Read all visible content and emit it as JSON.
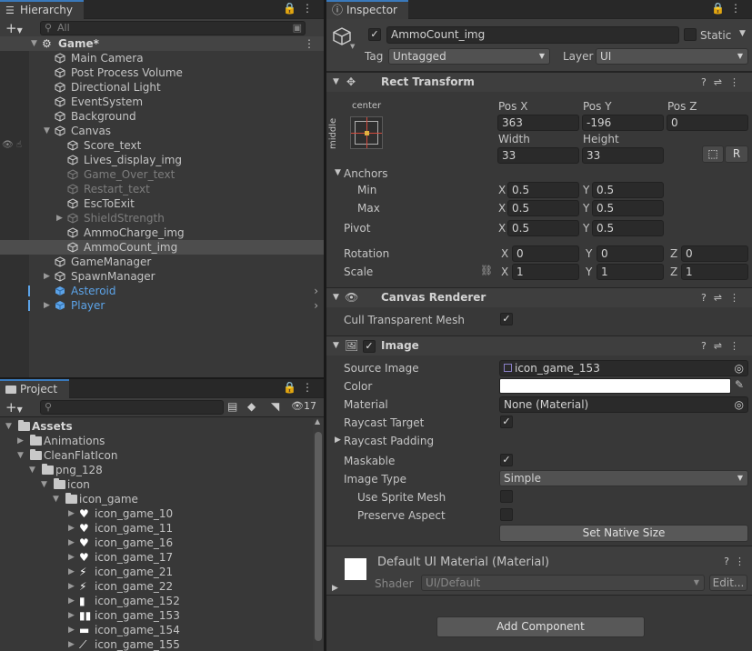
{
  "hierarchy": {
    "tab": "Hierarchy",
    "search_placeholder": "All",
    "root": "Game*",
    "items": [
      {
        "label": "Main Camera"
      },
      {
        "label": "Post Process Volume"
      },
      {
        "label": "Directional Light"
      },
      {
        "label": "EventSystem"
      },
      {
        "label": "Background"
      },
      {
        "label": "Canvas"
      },
      {
        "label": "Score_text"
      },
      {
        "label": "Lives_display_img"
      },
      {
        "label": "Game_Over_text"
      },
      {
        "label": "Restart_text"
      },
      {
        "label": "EscToExit"
      },
      {
        "label": "ShieldStrength"
      },
      {
        "label": "AmmoCharge_img"
      },
      {
        "label": "AmmoCount_img"
      },
      {
        "label": "GameManager"
      },
      {
        "label": "SpawnManager"
      },
      {
        "label": "Asteroid"
      },
      {
        "label": "Player"
      }
    ]
  },
  "project": {
    "tab": "Project",
    "badge": "17",
    "tree": [
      {
        "label": "Assets"
      },
      {
        "label": "Animations"
      },
      {
        "label": "CleanFlatIcon"
      },
      {
        "label": "png_128"
      },
      {
        "label": "icon"
      },
      {
        "label": "icon_game"
      },
      {
        "label": "icon_game_10"
      },
      {
        "label": "icon_game_11"
      },
      {
        "label": "icon_game_16"
      },
      {
        "label": "icon_game_17"
      },
      {
        "label": "icon_game_21"
      },
      {
        "label": "icon_game_22"
      },
      {
        "label": "icon_game_152"
      },
      {
        "label": "icon_game_153"
      },
      {
        "label": "icon_game_154"
      },
      {
        "label": "icon_game_155"
      }
    ]
  },
  "inspector": {
    "tab": "Inspector",
    "object_name": "AmmoCount_img",
    "static_label": "Static",
    "tag_label": "Tag",
    "tag_value": "Untagged",
    "layer_label": "Layer",
    "layer_value": "UI",
    "rect": {
      "title": "Rect Transform",
      "anchor_top": "center",
      "anchor_side": "middle",
      "posx_label": "Pos X",
      "posy_label": "Pos Y",
      "posz_label": "Pos Z",
      "posx": "363",
      "posy": "-196",
      "posz": "0",
      "width_label": "Width",
      "height_label": "Height",
      "width": "33",
      "height": "33",
      "r_label": "R",
      "anchors_label": "Anchors",
      "min_label": "Min",
      "max_label": "Max",
      "min_x": "0.5",
      "min_y": "0.5",
      "max_x": "0.5",
      "max_y": "0.5",
      "pivot_label": "Pivot",
      "pivot_x": "0.5",
      "pivot_y": "0.5",
      "rotation_label": "Rotation",
      "rot_x": "0",
      "rot_y": "0",
      "rot_z": "0",
      "scale_label": "Scale",
      "scale_x": "1",
      "scale_y": "1",
      "scale_z": "1",
      "x": "X",
      "y": "Y",
      "z": "Z"
    },
    "canvas_renderer": {
      "title": "Canvas Renderer",
      "cull_label": "Cull Transparent Mesh"
    },
    "image": {
      "title": "Image",
      "source_label": "Source Image",
      "source_value": "icon_game_153",
      "color_label": "Color",
      "material_label": "Material",
      "material_value": "None (Material)",
      "raycast_target_label": "Raycast Target",
      "raycast_padding_label": "Raycast Padding",
      "maskable_label": "Maskable",
      "image_type_label": "Image Type",
      "image_type_value": "Simple",
      "use_sprite_mesh_label": "Use Sprite Mesh",
      "preserve_aspect_label": "Preserve Aspect",
      "set_native_label": "Set Native Size"
    },
    "material": {
      "title": "Default UI Material (Material)",
      "shader_label": "Shader",
      "shader_value": "UI/Default",
      "edit_label": "Edit..."
    },
    "add_component": "Add Component"
  }
}
